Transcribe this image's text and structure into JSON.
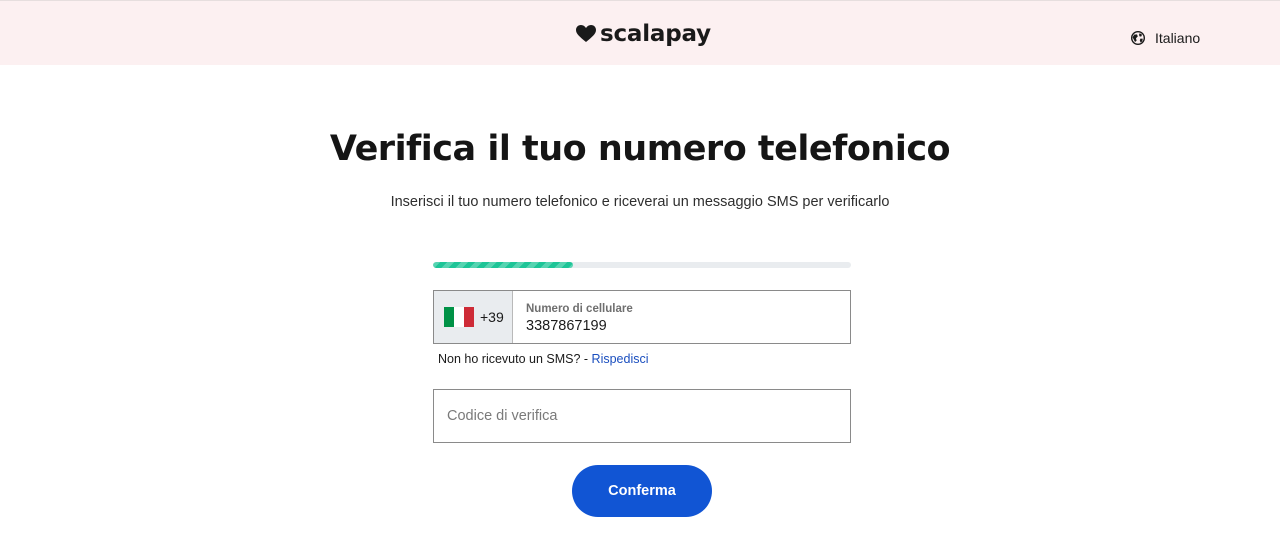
{
  "header": {
    "brand": "scalapay",
    "language": "Italiano",
    "colors": {
      "background": "#fcf0f1"
    }
  },
  "main": {
    "title": "Verifica il tuo numero telefonico",
    "subtitle": "Inserisci il tuo numero telefonico e riceverai un messaggio SMS per verificarlo",
    "progress": {
      "fraction": 0.335,
      "color": "#1dc597"
    },
    "phone": {
      "country_flag": "flag-italy-icon",
      "dial_code": "+39",
      "label": "Numero di cellulare",
      "value": "3387867199"
    },
    "resend": {
      "text": "Non ho ricevuto un SMS? - ",
      "link": "Rispedisci",
      "link_color": "#1b4fbf"
    },
    "code": {
      "placeholder": "Codice di verifica",
      "value": ""
    },
    "confirm_button": {
      "label": "Conferma",
      "color": "#1155d4"
    }
  }
}
